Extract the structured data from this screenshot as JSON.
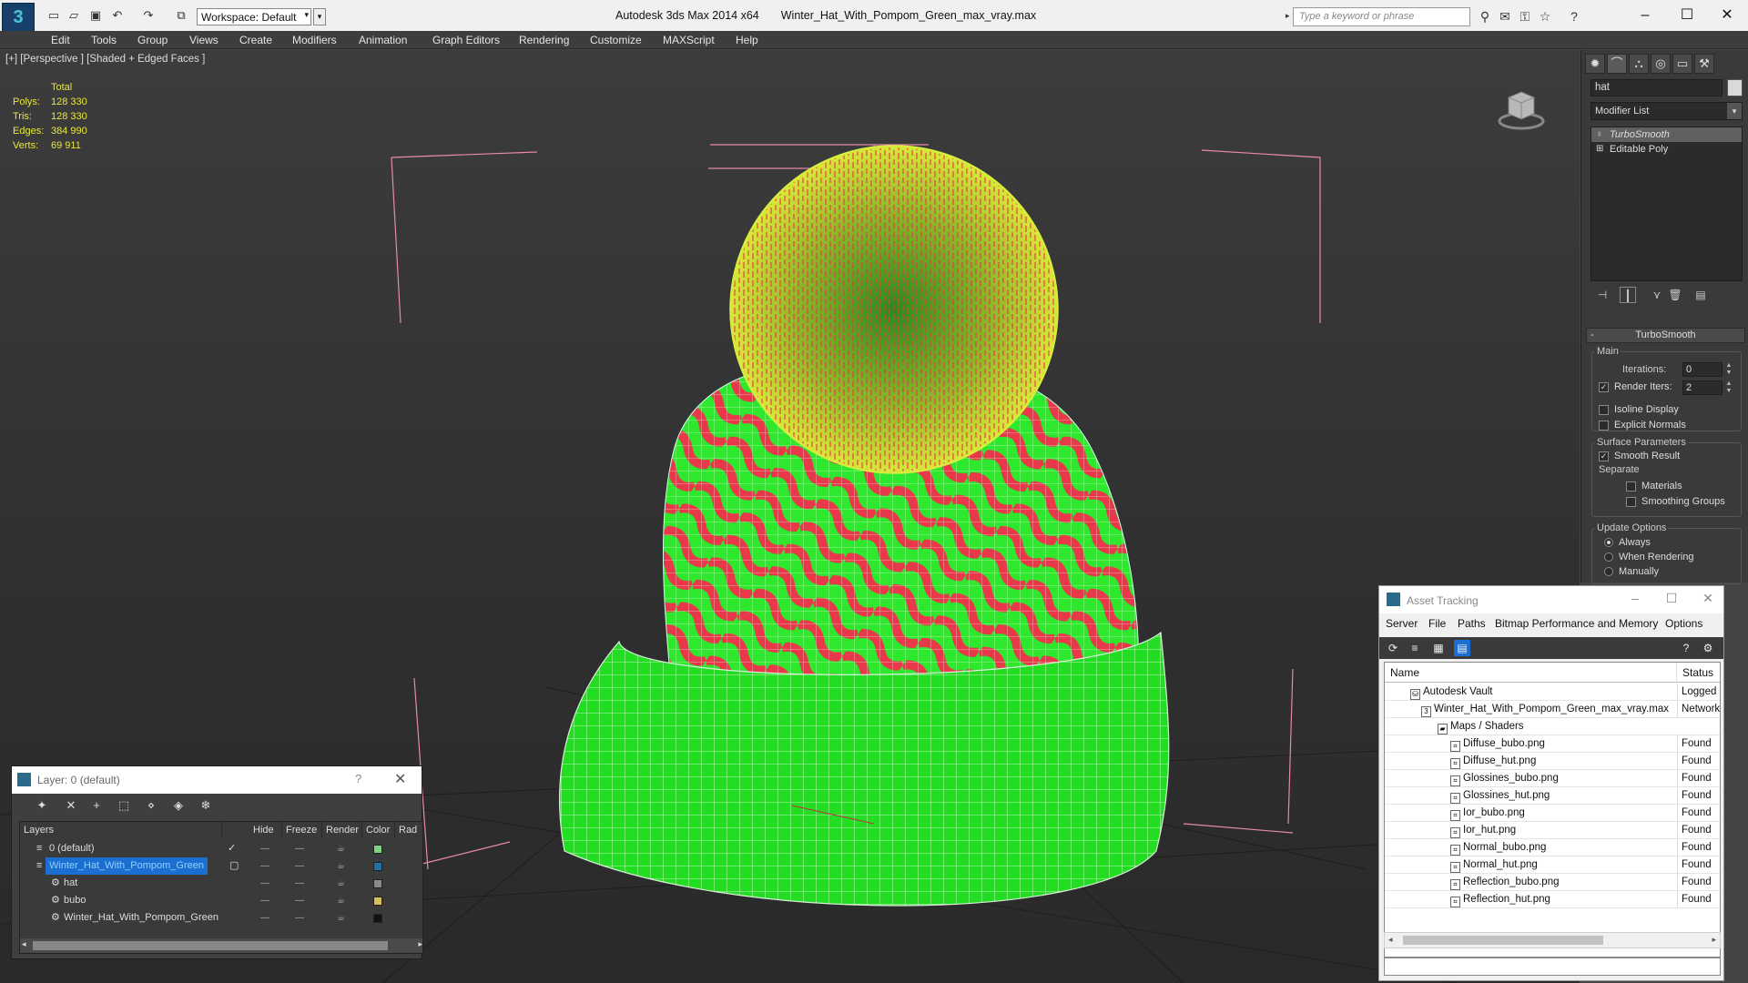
{
  "titlebar": {
    "workspace": "Workspace: Default",
    "app_name": "Autodesk 3ds Max  2014 x64",
    "file_name": "Winter_Hat_With_Pompom_Green_max_vray.max",
    "search_placeholder": "Type a keyword or phrase"
  },
  "menu": [
    "Edit",
    "Tools",
    "Group",
    "Views",
    "Create",
    "Modifiers",
    "Animation",
    "Graph Editors",
    "Rendering",
    "Customize",
    "MAXScript",
    "Help"
  ],
  "viewport": {
    "label": "[+] [Perspective ] [Shaded + Edged Faces ]",
    "stats": {
      "header": "Total",
      "rows": [
        {
          "label": "Polys:",
          "value": "128 330"
        },
        {
          "label": "Tris:",
          "value": "128 330"
        },
        {
          "label": "Edges:",
          "value": "384 990"
        },
        {
          "label": "Verts:",
          "value": "69 911"
        }
      ]
    }
  },
  "command_panel": {
    "object_name": "hat",
    "modifier_list": "Modifier List",
    "stack": [
      "TurboSmooth",
      "Editable Poly"
    ],
    "turbosmooth": {
      "title": "TurboSmooth",
      "main_label": "Main",
      "iterations_label": "Iterations:",
      "iterations_value": "0",
      "render_iters_label": "Render Iters:",
      "render_iters_value": "2",
      "isoline": "Isoline Display",
      "explicit_normals": "Explicit Normals",
      "surface_label": "Surface Parameters",
      "smooth_result": "Smooth Result",
      "separate_label": "Separate",
      "materials": "Materials",
      "smoothing_groups": "Smoothing Groups",
      "update_label": "Update Options",
      "always": "Always",
      "when_rendering": "When Rendering",
      "manually": "Manually"
    }
  },
  "layer_dialog": {
    "title": "Layer: 0 (default)",
    "help": "?",
    "columns": [
      "Layers",
      "Hide",
      "Freeze",
      "Render",
      "Color",
      "Rad"
    ],
    "rows": [
      {
        "name": "0 (default)",
        "color": "#7fd07f"
      },
      {
        "name": "Winter_Hat_With_Pompom_Green",
        "color": "#1f6fa8"
      },
      {
        "name": "hat",
        "color": "#8a8a8a"
      },
      {
        "name": "bubo",
        "color": "#d8c050"
      },
      {
        "name": "Winter_Hat_With_Pompom_Green",
        "color": "#111111"
      }
    ]
  },
  "asset_dialog": {
    "title": "Asset Tracking",
    "menu": [
      "Server",
      "File",
      "Paths",
      "Bitmap Performance and Memory",
      "Options"
    ],
    "columns": [
      "Name",
      "Status"
    ],
    "rows": [
      {
        "name": "Autodesk Vault",
        "status": "Logged Out"
      },
      {
        "name": "Winter_Hat_With_Pompom_Green_max_vray.max",
        "status": "Network"
      },
      {
        "name": "Maps / Shaders",
        "status": ""
      },
      {
        "name": "Diffuse_bubo.png",
        "status": "Found"
      },
      {
        "name": "Diffuse_hut.png",
        "status": "Found"
      },
      {
        "name": "Glossines_bubo.png",
        "status": "Found"
      },
      {
        "name": "Glossines_hut.png",
        "status": "Found"
      },
      {
        "name": "Ior_bubo.png",
        "status": "Found"
      },
      {
        "name": "Ior_hut.png",
        "status": "Found"
      },
      {
        "name": "Normal_bubo.png",
        "status": "Found"
      },
      {
        "name": "Normal_hut.png",
        "status": "Found"
      },
      {
        "name": "Reflection_bubo.png",
        "status": "Found"
      },
      {
        "name": "Reflection_hut.png",
        "status": "Found"
      }
    ]
  },
  "colors": {
    "hat_green": "#2ee82e",
    "hat_red": "#e8384a",
    "pompom_yellow": "#c8e030",
    "stats_yellow": "#e8e840",
    "selection_blue": "#1c6fd0"
  }
}
